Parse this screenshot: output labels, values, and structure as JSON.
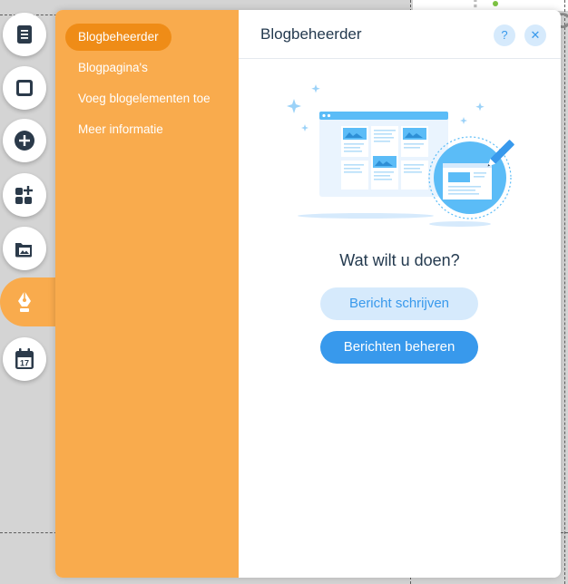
{
  "colors": {
    "menu_bg": "#f9ab4d",
    "menu_active": "#ef8c17",
    "accent_blue": "#3899ec",
    "accent_light": "#d6eafc",
    "title_text": "#243a4f",
    "rail_icon": "#2b3a4a"
  },
  "left_rail": {
    "items": [
      {
        "icon": "pages-icon"
      },
      {
        "icon": "background-icon"
      },
      {
        "icon": "add-plus-icon"
      },
      {
        "icon": "app-market-icon"
      },
      {
        "icon": "media-folder-icon"
      },
      {
        "icon": "blog-pen-icon",
        "active": true
      },
      {
        "icon": "calendar-icon",
        "badge": "17"
      }
    ]
  },
  "panel": {
    "menu": [
      {
        "label": "Blogbeheerder",
        "active": true
      },
      {
        "label": "Blogpagina's"
      },
      {
        "label": "Voeg blogelementen toe"
      },
      {
        "label": "Meer informatie"
      }
    ],
    "title": "Blogbeheerder",
    "help_glyph": "?",
    "close_glyph": "✕",
    "illustration_icon": "blog-illustration",
    "question": "Wat wilt u doen?",
    "primary_action": "Berichten beheren",
    "secondary_action": "Bericht schrijven"
  }
}
